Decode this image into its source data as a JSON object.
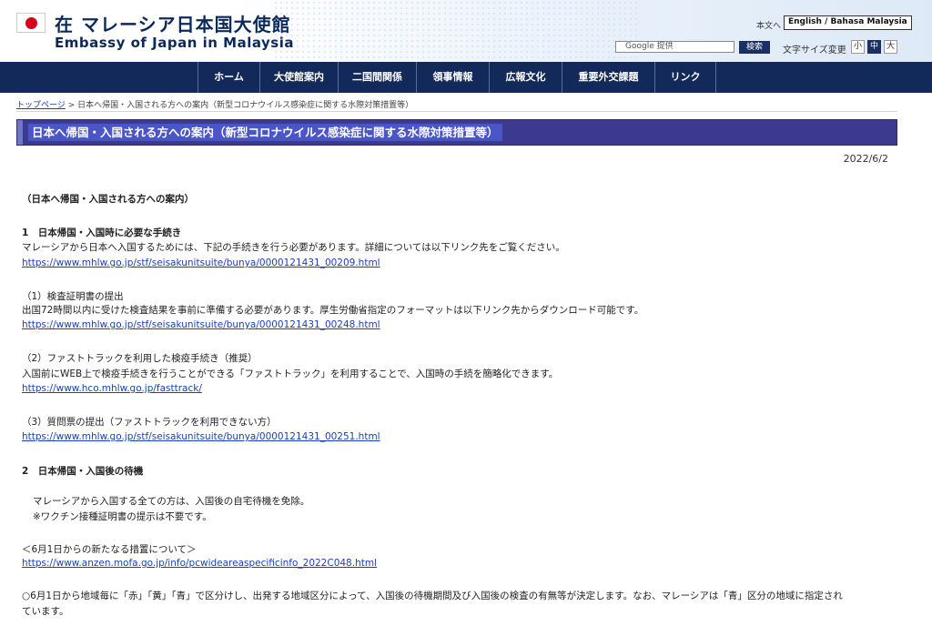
{
  "header": {
    "title_jp": "在 マレーシア日本国大使館",
    "title_en": "Embassy of Japan in Malaysia",
    "lang_current": "本文へ",
    "lang_switch": "English / Bahasa Malaysia",
    "search_placeholder": "Google 提供",
    "search_button": "検索",
    "fontsize_label": "文字サイズ変更",
    "fontsize_small": "小",
    "fontsize_mid": "中",
    "fontsize_large": "大"
  },
  "nav": {
    "items": [
      "ホーム",
      "大使館案内",
      "二国間関係",
      "領事情報",
      "広報文化",
      "重要外交課題",
      "リンク"
    ]
  },
  "breadcrumb": {
    "top": "トップページ",
    "separator": ">",
    "current": "日本へ帰国・入国される方への案内（新型コロナウイルス感染症に関する水際対策措置等）"
  },
  "page": {
    "title": "日本へ帰国・入国される方への案内（新型コロナウイルス感染症に関する水際対策措置等）",
    "date": "2022/6/2"
  },
  "content": {
    "intro_heading": "（日本へ帰国・入国される方への案内）",
    "s1_heading": "1　日本帰国・入国時に必要な手続き",
    "s1_text": "マレーシアから日本へ入国するためには、下記の手続きを行う必要があります。詳細については以下リンク先をご覧ください。",
    "s1_link": "https://www.mhlw.go.jp/stf/seisakunitsuite/bunya/0000121431_00209.html",
    "s1a_heading": "（1）検査証明書の提出",
    "s1a_text": "出国72時間以内に受けた検査結果を事前に準備する必要があります。厚生労働省指定のフォーマットは以下リンク先からダウンロード可能です。",
    "s1a_link": "https://www.mhlw.go.jp/stf/seisakunitsuite/bunya/0000121431_00248.html",
    "s1b_heading": "（2）ファストトラックを利用した検疫手続き（推奨）",
    "s1b_text": "入国前にWEB上で検疫手続きを行うことができる「ファストトラック」を利用することで、入国時の手続を簡略化できます。",
    "s1b_link": "https://www.hco.mhlw.go.jp/fasttrack/",
    "s1c_heading": "（3）質問票の提出（ファストトラックを利用できない方）",
    "s1c_link": "https://www.mhlw.go.jp/stf/seisakunitsuite/bunya/0000121431_00251.html",
    "s2_heading": "2　日本帰国・入国後の待機",
    "s2_text1": "マレーシアから入国する全ての方は、入国後の自宅待機を免除。",
    "s2_text2": "※ワクチン接種証明書の提示は不要です。",
    "s3_heading": "＜6月1日からの新たなる措置について＞",
    "s3_link": "https://www.anzen.mofa.go.jp/info/pcwideareaspecificinfo_2022C048.html",
    "s3_text1": "○6月1日から地域毎に「赤」「黄」「青」で区分けし、出発する地域区分によって、入国後の待機期間及び入国後の検査の有無等が決定します。なお、マレーシアは「青」区分の地域に指定され",
    "s3_text2": "ています。"
  }
}
